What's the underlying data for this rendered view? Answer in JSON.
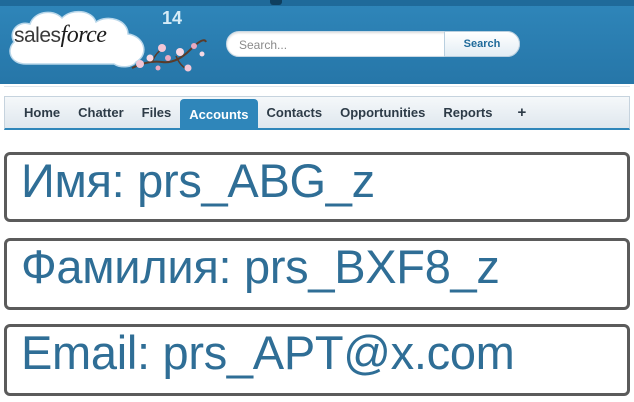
{
  "header": {
    "logo_prefix": "sales",
    "logo_suffix": "force",
    "version": "14",
    "search": {
      "placeholder": "Search...",
      "button_label": "Search"
    }
  },
  "tabs": [
    {
      "label": "Home"
    },
    {
      "label": "Chatter"
    },
    {
      "label": "Files"
    },
    {
      "label": "Accounts",
      "active": true
    },
    {
      "label": "Contacts"
    },
    {
      "label": "Opportunities"
    },
    {
      "label": "Reports"
    },
    {
      "label": "+"
    }
  ],
  "fields": {
    "first_name": "Имя: prs_ABG_z",
    "last_name": "Фамилия: prs_BXF8_z",
    "email": "Email: prs_APT@x.com"
  },
  "colors": {
    "header_blue": "#2f86ba",
    "field_text": "#2f6e96",
    "box_border": "#5b5b5b"
  },
  "icons": [
    "salesforce-cloud-logo",
    "cherry-blossom-icon",
    "plus-icon"
  ]
}
